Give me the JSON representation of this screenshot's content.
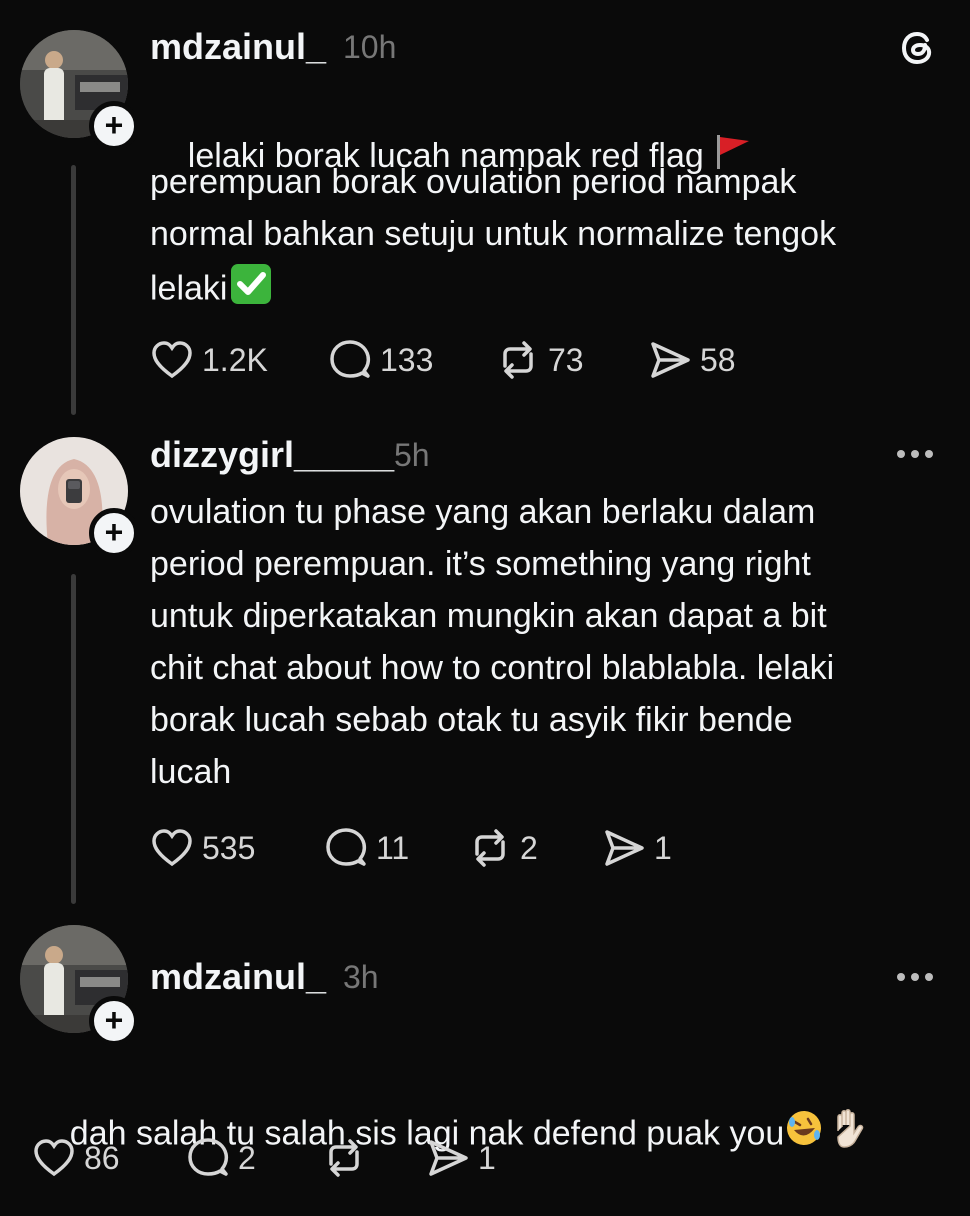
{
  "posts": [
    {
      "username": "mdzainul_",
      "time": "10h",
      "text_parts": [
        "lelaki borak lucah nampak red flag ",
        "perempuan borak ovulation period nampak\nnormal bahkan setuju untuk normalize tengok\nlelaki"
      ],
      "likes": "1.2K",
      "comments": "133",
      "reposts": "73",
      "shares": "58"
    },
    {
      "username": "dizzygirl_____",
      "time": "5h",
      "text": "ovulation tu phase yang akan berlaku dalam\nperiod perempuan. it’s something yang right\nuntuk diperkatakan mungkin akan dapat a bit\nchit chat about how to control blablabla. lelaki\nborak lucah sebab otak tu asyik fikir bende\nlucah",
      "likes": "535",
      "comments": "11",
      "reposts": "2",
      "shares": "1"
    },
    {
      "username": "mdzainul_",
      "time": "3h",
      "text": "dah salah tu salah sis lagi nak defend puak you",
      "likes": "86",
      "comments": "2",
      "reposts": "",
      "shares": "1"
    }
  ],
  "icons": {
    "app": "threads-logo-icon",
    "like": "heart-icon",
    "comment": "comment-bubble-icon",
    "repost": "repost-icon",
    "share": "send-icon"
  }
}
